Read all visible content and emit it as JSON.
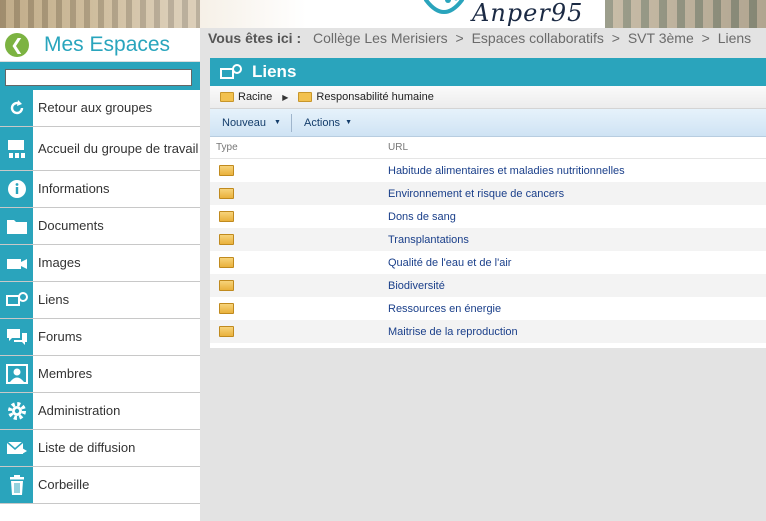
{
  "banner": {
    "logo_text": "Anper95"
  },
  "sidebar": {
    "title": "Mes Espaces",
    "search_value": "",
    "items": [
      {
        "label": "Retour aux groupes",
        "icon": "refresh-icon"
      },
      {
        "label": "Accueil du groupe de travail",
        "icon": "group-home-icon"
      },
      {
        "label": "Informations",
        "icon": "info-icon"
      },
      {
        "label": "Documents",
        "icon": "folder-icon"
      },
      {
        "label": "Images",
        "icon": "camera-icon"
      },
      {
        "label": "Liens",
        "icon": "links-icon"
      },
      {
        "label": "Forums",
        "icon": "forum-icon"
      },
      {
        "label": "Membres",
        "icon": "members-icon"
      },
      {
        "label": "Administration",
        "icon": "gear-icon"
      },
      {
        "label": "Liste de diffusion",
        "icon": "mail-icon"
      },
      {
        "label": "Corbeille",
        "icon": "trash-icon"
      }
    ]
  },
  "breadcrumb": {
    "prefix": "Vous êtes ici :",
    "items": [
      "Collège Les Merisiers",
      "Espaces collaboratifs",
      "SVT 3ème",
      "Liens"
    ]
  },
  "panel": {
    "title": "Liens",
    "path": [
      "Racine",
      "Responsabilité humaine"
    ],
    "toolbar": {
      "new_label": "Nouveau",
      "actions_label": "Actions"
    },
    "columns": {
      "type": "Type",
      "url": "URL"
    },
    "rows": [
      "Habitude alimentaires et maladies nutritionnelles",
      "Environnement et risque de cancers",
      "Dons de sang",
      "Transplantations",
      "Qualité de l'eau et de l'air",
      "Biodiversité",
      "Ressources en énergie",
      "Maitrise de la reproduction"
    ]
  },
  "colors": {
    "accent": "#2aa4bc",
    "link": "#1a3f8a",
    "back_button": "#7cb342"
  }
}
